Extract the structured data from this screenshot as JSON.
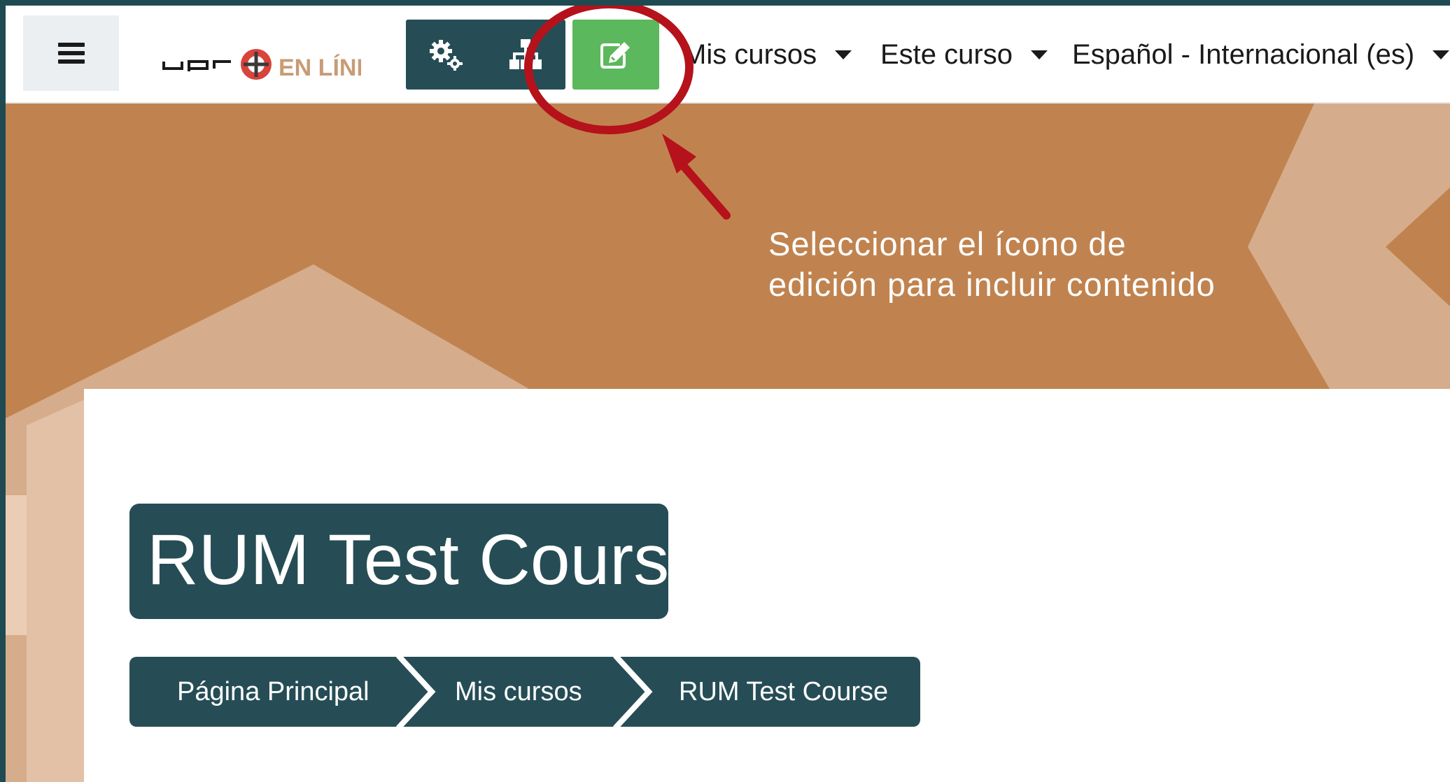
{
  "navbar": {
    "logo": {
      "upr_text": "upr",
      "brand_text": "EN LÍNEA"
    },
    "menus": [
      {
        "label": "Mis cursos"
      },
      {
        "label": "Este curso"
      },
      {
        "label": "Español - Internacional (es)"
      }
    ]
  },
  "annotation": {
    "line1": "Seleccionar el ícono de",
    "line2": "edición para incluir contenido"
  },
  "course": {
    "title": "RUM Test Course"
  },
  "breadcrumb": {
    "items": [
      "Página Principal",
      "Mis cursos",
      "RUM Test Course"
    ]
  },
  "icons": {
    "menu": "hamburger-icon",
    "settings": "gears-icon",
    "navigation": "sitemap-icon",
    "edit": "pencil-square-icon"
  },
  "colors": {
    "dark_teal": "#264d55",
    "edit_green": "#5cb85c",
    "banner": "#c0834f",
    "highlight_red": "#b5121b"
  }
}
